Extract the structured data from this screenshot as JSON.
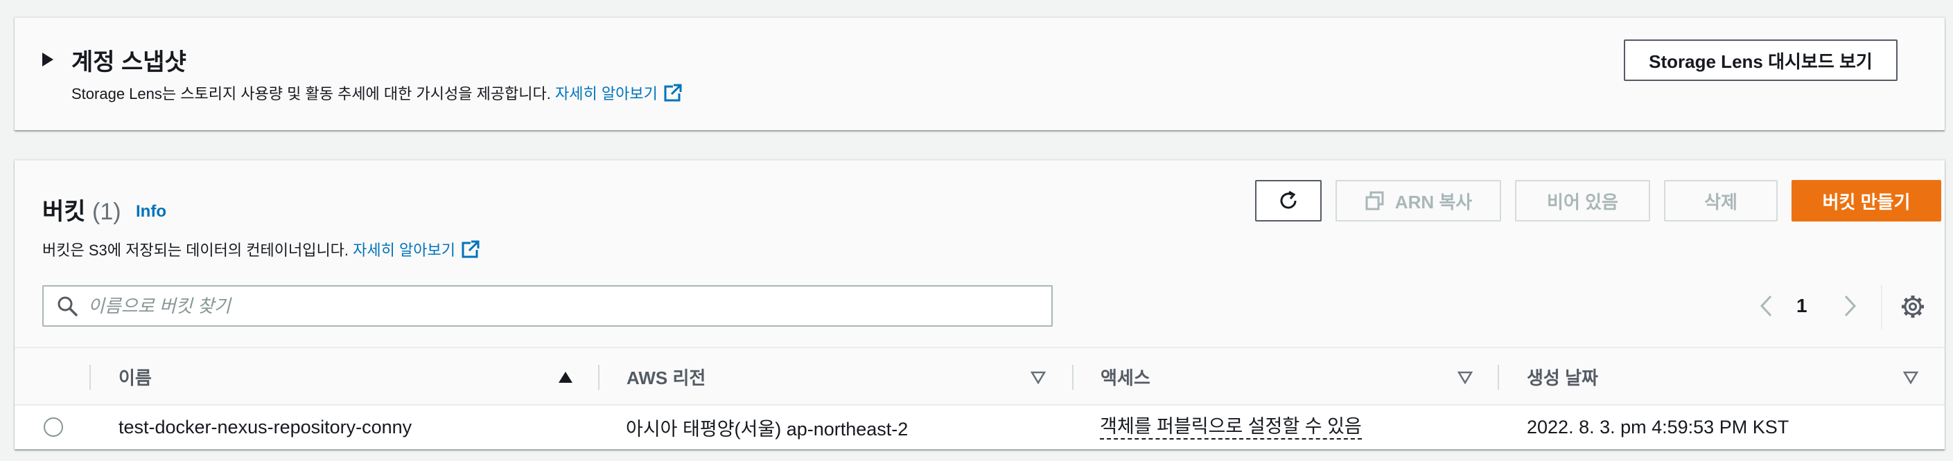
{
  "storage_lens": {
    "title": "계정 스냅샷",
    "description": "Storage Lens는 스토리지 사용량 및 활동 추세에 대한 가시성을 제공합니다.",
    "learn_more": "자세히 알아보기",
    "dashboard_button": "Storage Lens 대시보드 보기"
  },
  "buckets": {
    "title": "버킷",
    "count": "(1)",
    "info": "Info",
    "description": "버킷은 S3에 저장되는 데이터의 컨테이너입니다.",
    "learn_more": "자세히 알아보기",
    "buttons": {
      "copy_arn": "ARN 복사",
      "empty": "비어 있음",
      "delete": "삭제",
      "create": "버킷 만들기"
    },
    "search_placeholder": "이름으로 버킷 찾기",
    "page": "1",
    "columns": [
      "이름",
      "AWS 리전",
      "액세스",
      "생성 날짜"
    ],
    "rows": [
      {
        "name": "test-docker-nexus-repository-conny",
        "region": "아시아 태평양(서울) ap-northeast-2",
        "access": "객체를 퍼블릭으로 설정할 수 있음",
        "created": "2022. 8. 3. pm 4:59:53 PM KST"
      }
    ]
  },
  "colors": {
    "link": "#0073bb",
    "primary_button": "#ec7211",
    "disabled_text": "#aab7b8",
    "background": "#f2f3f3"
  },
  "icons": [
    "expand-caret-icon",
    "external-link-icon",
    "refresh-icon",
    "copy-icon",
    "search-icon",
    "chevron-left-icon",
    "chevron-right-icon",
    "settings-gear-icon",
    "sort-ascending-icon",
    "sort-descending-icon",
    "radio-button"
  ]
}
